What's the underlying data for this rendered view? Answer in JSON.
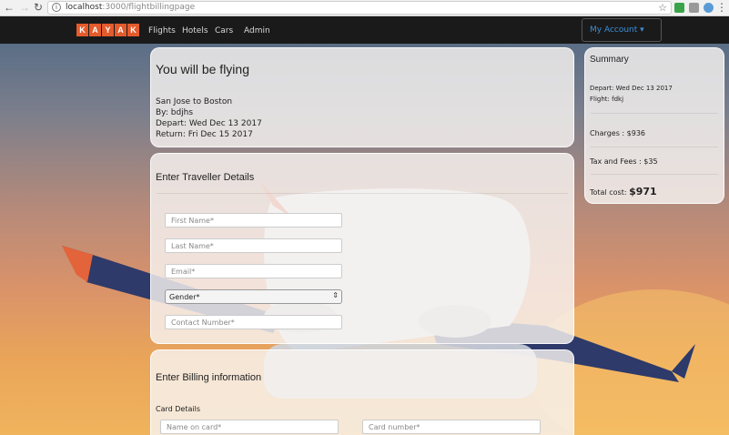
{
  "browser": {
    "url_host": "localhost",
    "url_path": ":3000/flightbillingpage"
  },
  "navbar": {
    "logo_letters": [
      "K",
      "A",
      "Y",
      "A",
      "K"
    ],
    "links": [
      "Flights",
      "Hotels",
      "Cars",
      "Admin"
    ],
    "account_label": "My Account ▾"
  },
  "flight_card": {
    "title": "You will be flying",
    "route": "San Jose to Boston",
    "by": "By: bdjhs",
    "depart": "Depart: Wed Dec 13 2017",
    "return": "Return: Fri Dec 15 2017"
  },
  "traveller_card": {
    "title": "Enter Traveller Details",
    "first_name_placeholder": "First Name*",
    "last_name_placeholder": "Last Name*",
    "email_placeholder": "Email*",
    "gender_value": "Gender*",
    "contact_placeholder": "Contact Number*"
  },
  "billing_card": {
    "title": "Enter Billing information",
    "card_details_label": "Card Details",
    "name_on_card_placeholder": "Name on card*",
    "card_number_placeholder": "Card number*"
  },
  "summary": {
    "title": "Summary",
    "depart": "Depart: Wed Dec 13 2017",
    "flight": "Flight: fdkj",
    "charges": "Charges : $936",
    "tax": "Tax and Fees : $35",
    "total_label": "Total cost: ",
    "total_value": "$971"
  },
  "colors": {
    "brand": "#e45b2c",
    "navbar": "#1a1a1a",
    "account_link": "#3a8fd9"
  }
}
